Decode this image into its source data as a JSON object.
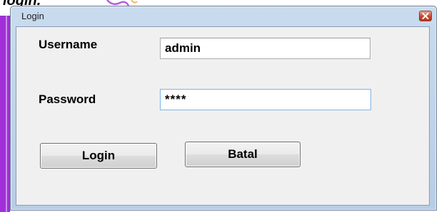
{
  "background": {
    "caption_fragment": "login."
  },
  "window": {
    "title": "Login",
    "close_icon": "close-icon"
  },
  "form": {
    "username_label": "Username",
    "username_value": "admin",
    "password_label": "Password",
    "password_value": "****"
  },
  "buttons": {
    "login_label": "Login",
    "batal_label": "Batal"
  },
  "colors": {
    "window_frame": "#b7cde6",
    "client_bg": "#f0f0f0",
    "close_button": "#c8442a",
    "background_accent": "#a02fd8",
    "password_focus_border": "#7eb4ea"
  }
}
